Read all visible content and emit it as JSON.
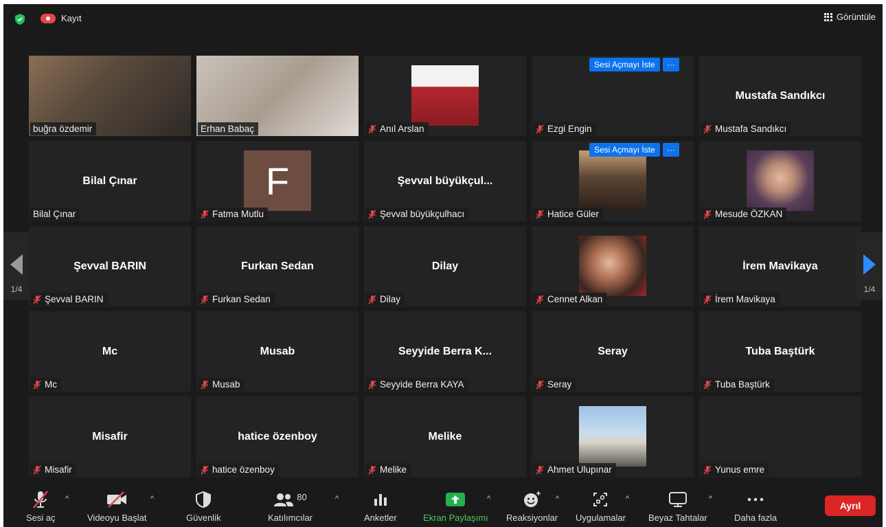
{
  "topbar": {
    "recording_label": "Kayıt",
    "view_label": "Görüntüle"
  },
  "pager": {
    "left": "1/4",
    "right": "1/4"
  },
  "tiles": [
    {
      "display": "",
      "label": "buğra özdemir",
      "muted": false,
      "kind": "video1",
      "active": true
    },
    {
      "display": "",
      "label": "Erhan Babaç",
      "muted": false,
      "kind": "video2"
    },
    {
      "display": "",
      "label": "Anıl Arslan",
      "muted": true,
      "kind": "photo",
      "photo": "portrait-red"
    },
    {
      "display": "",
      "label": "Ezgi Engin",
      "muted": true,
      "kind": "empty",
      "ask": true
    },
    {
      "display": "Mustafa Sandıkcı",
      "label": "Mustafa Sandıkcı",
      "muted": true,
      "kind": "name"
    },
    {
      "display": "Bilal Çınar",
      "label": "Bilal Çınar",
      "muted": false,
      "kind": "name"
    },
    {
      "display": "F",
      "label": "Fatma Mutlu",
      "muted": true,
      "kind": "avatar"
    },
    {
      "display": "Şevval  büyükçul...",
      "label": "Şevval büyükçulhacı",
      "muted": true,
      "kind": "name"
    },
    {
      "display": "",
      "label": "Hatice Güler",
      "muted": true,
      "kind": "photo",
      "photo": "portrait-dark",
      "ask": true
    },
    {
      "display": "",
      "label": "Mesude ÖZKAN",
      "muted": true,
      "kind": "photo",
      "photo": "portrait-purple"
    },
    {
      "display": "Şevval BARIN",
      "label": "Şevval BARIN",
      "muted": true,
      "kind": "name"
    },
    {
      "display": "Furkan Sedan",
      "label": "Furkan Sedan",
      "muted": true,
      "kind": "name"
    },
    {
      "display": "Dilay",
      "label": "Dilay",
      "muted": true,
      "kind": "name"
    },
    {
      "display": "",
      "label": "Cennet Alkan",
      "muted": true,
      "kind": "photo",
      "photo": "portrait-warm"
    },
    {
      "display": "İrem Mavikaya",
      "label": "İrem Mavikaya",
      "muted": true,
      "kind": "name"
    },
    {
      "display": "Mc",
      "label": "Mc",
      "muted": true,
      "kind": "name"
    },
    {
      "display": "Musab",
      "label": "Musab",
      "muted": true,
      "kind": "name"
    },
    {
      "display": "Seyyide Berra K...",
      "label": "Seyyide Berra KAYA",
      "muted": true,
      "kind": "name"
    },
    {
      "display": "Seray",
      "label": "Seray",
      "muted": true,
      "kind": "name"
    },
    {
      "display": "Tuba Baştürk",
      "label": "Tuba Baştürk",
      "muted": true,
      "kind": "name"
    },
    {
      "display": "Misafir",
      "label": "Misafir",
      "muted": true,
      "kind": "name"
    },
    {
      "display": "hatice özenboy",
      "label": "hatice özenboy",
      "muted": true,
      "kind": "name"
    },
    {
      "display": "Melike",
      "label": "Melike",
      "muted": true,
      "kind": "name"
    },
    {
      "display": "",
      "label": "Ahmet Ulupınar",
      "muted": true,
      "kind": "photo",
      "photo": "landscape-sky"
    },
    {
      "display": "",
      "label": "Yunus emre",
      "muted": true,
      "kind": "empty"
    }
  ],
  "ask_unmute": {
    "label": "Sesi Açmayı İste",
    "more": "···"
  },
  "toolbar": {
    "unmute": "Sesi aç",
    "start_video": "Videoyu Başlat",
    "security": "Güvenlik",
    "participants": "Katılımcılar",
    "participants_count": "80",
    "polls": "Anketler",
    "share_screen": "Ekran Paylaşımı",
    "reactions": "Reaksiyonlar",
    "apps": "Uygulamalar",
    "whiteboards": "Beyaz Tahtalar",
    "more": "Daha fazla",
    "leave": "Ayrıl"
  },
  "colors": {
    "active_border": "#c6e36b",
    "mute_red": "#e5474d",
    "share_green": "#4dcc5a",
    "leave_red": "#dc2626",
    "ask_blue": "#0e72ed"
  }
}
